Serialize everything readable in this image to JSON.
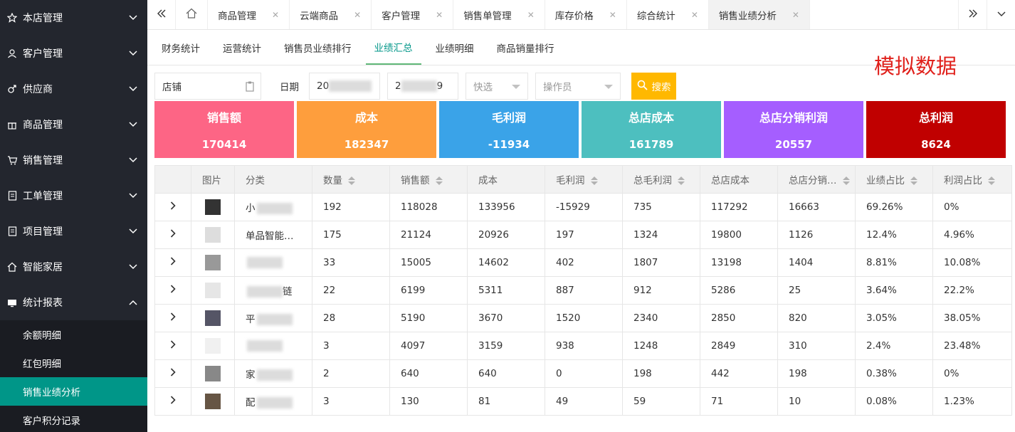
{
  "sidebar": {
    "items": [
      {
        "label": "本店管理",
        "icon": "star-icon"
      },
      {
        "label": "客户管理",
        "icon": "user-icon"
      },
      {
        "label": "供应商",
        "icon": "male-icon"
      },
      {
        "label": "商品管理",
        "icon": "gift-icon"
      },
      {
        "label": "销售管理",
        "icon": "cart-icon"
      },
      {
        "label": "工单管理",
        "icon": "document-icon"
      },
      {
        "label": "项目管理",
        "icon": "document-icon"
      },
      {
        "label": "智能家居",
        "icon": "home-icon"
      },
      {
        "label": "统计报表",
        "icon": "monitor-icon"
      }
    ],
    "sub_items": [
      "余额明细",
      "红包明细",
      "销售业绩分析",
      "客户积分记录"
    ]
  },
  "tabs": [
    "商品管理",
    "云端商品",
    "客户管理",
    "销售单管理",
    "库存价格",
    "综合统计",
    "销售业绩分析"
  ],
  "subtabs": [
    "财务统计",
    "运营统计",
    "销售员业绩排行",
    "业绩汇总",
    "业绩明细",
    "商品销量排行"
  ],
  "watermark": "模拟数据",
  "filters": {
    "store": "店铺",
    "date_label": "日期",
    "date_start_prefix": "20",
    "date_end_prefix": "2",
    "date_end_suffix": "9",
    "quick": "快选",
    "operator": "操作员",
    "search": "搜索"
  },
  "cards": [
    {
      "title": "销售额",
      "value": "170414",
      "color": "#fd6585"
    },
    {
      "title": "成本",
      "value": "182347",
      "color": "#fe9e3d"
    },
    {
      "title": "毛利润",
      "value": "-11934",
      "color": "#3aa3e8"
    },
    {
      "title": "总店成本",
      "value": "161789",
      "color": "#4dbfbf"
    },
    {
      "title": "总店分销利润",
      "value": "20557",
      "color": "#a55eff"
    },
    {
      "title": "总利润",
      "value": "8624",
      "color": "#c00000"
    }
  ],
  "table": {
    "headers": [
      "",
      "图片",
      "分类",
      "数量",
      "销售额",
      "成本",
      "毛利润",
      "总毛利润",
      "总店成本",
      "总店分销…",
      "业绩占比",
      "利润占比"
    ],
    "rows": [
      [
        "小",
        "192",
        "118028",
        "133956",
        "-15929",
        "735",
        "117292",
        "16663",
        "69.26%",
        "0%"
      ],
      [
        "单品智能…",
        "175",
        "21124",
        "20926",
        "197",
        "1324",
        "19800",
        "1126",
        "12.4%",
        "4.96%"
      ],
      [
        "",
        "33",
        "15005",
        "14602",
        "402",
        "1807",
        "13198",
        "1404",
        "8.81%",
        "10.08%"
      ],
      [
        "链",
        "22",
        "6199",
        "5311",
        "887",
        "912",
        "5286",
        "25",
        "3.64%",
        "22.2%"
      ],
      [
        "平",
        "28",
        "5190",
        "3670",
        "1520",
        "2340",
        "2850",
        "820",
        "3.05%",
        "38.05%"
      ],
      [
        "",
        "3",
        "4097",
        "3159",
        "938",
        "1248",
        "2849",
        "310",
        "2.4%",
        "23.48%"
      ],
      [
        "家",
        "2",
        "640",
        "640",
        "0",
        "198",
        "442",
        "198",
        "0.38%",
        "0%"
      ],
      [
        "配",
        "3",
        "130",
        "81",
        "49",
        "59",
        "71",
        "10",
        "0.08%",
        "1.23%"
      ]
    ]
  }
}
